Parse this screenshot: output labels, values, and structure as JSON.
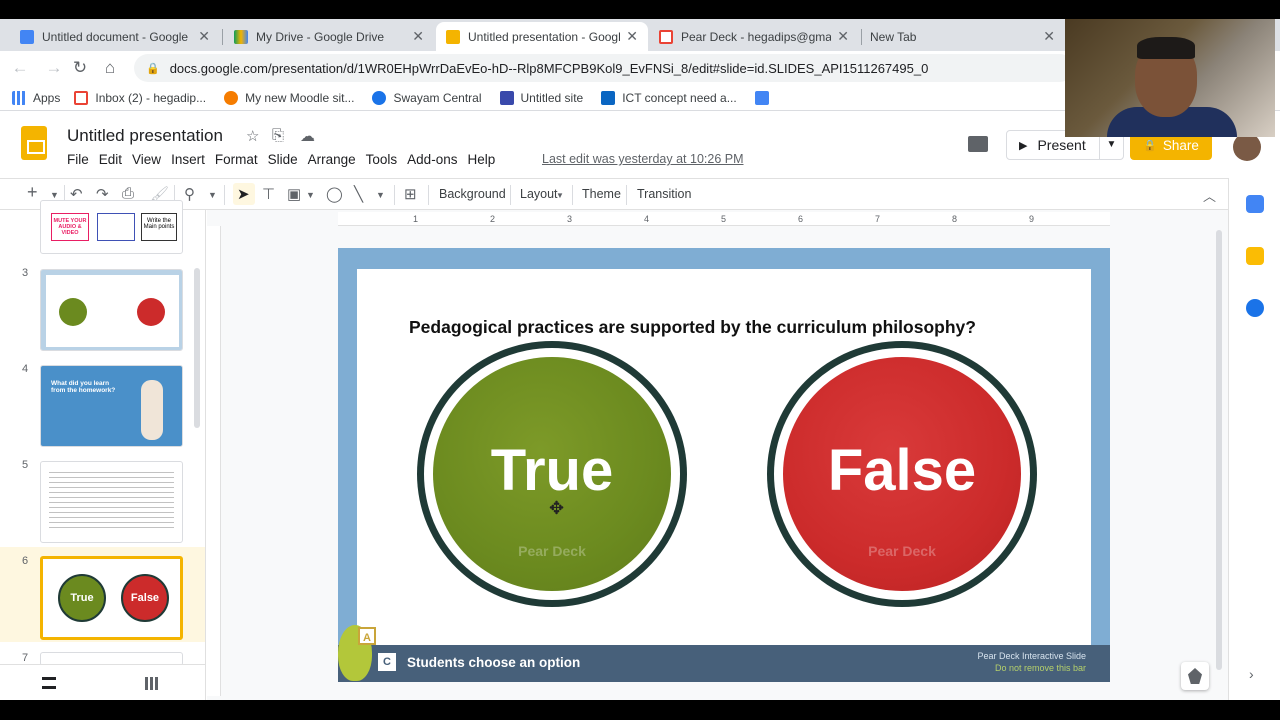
{
  "browser": {
    "tabs": [
      {
        "title": "Untitled document - Google D",
        "active": false
      },
      {
        "title": "My Drive - Google Drive",
        "active": false
      },
      {
        "title": "Untitled presentation - Google",
        "active": true
      },
      {
        "title": "Pear Deck - hegadips@gmail.c",
        "active": false
      },
      {
        "title": "New Tab",
        "active": false
      }
    ],
    "url": "docs.google.com/presentation/d/1WR0EHpWrrDaEvEo-hD--Rlp8MFCPB9Kol9_EvFNSi_8/edit#slide=id.SLIDES_API1511267495_0",
    "bookmarks": [
      {
        "label": "Apps",
        "color": "#4285f4"
      },
      {
        "label": "Inbox (2) - hegadip...",
        "color": "#ea4335"
      },
      {
        "label": "My new Moodle sit...",
        "color": "#f57c00"
      },
      {
        "label": "Swayam Central",
        "color": "#1a73e8"
      },
      {
        "label": "Untitled site",
        "color": "#3949ab"
      },
      {
        "label": "ICT concept need a...",
        "color": "#0a66c2"
      },
      {
        "label": "",
        "color": "#4285f4"
      }
    ]
  },
  "doc": {
    "title": "Untitled presentation",
    "menu": [
      "File",
      "Edit",
      "View",
      "Insert",
      "Format",
      "Slide",
      "Arrange",
      "Tools",
      "Add-ons",
      "Help"
    ],
    "last_edit": "Last edit was yesterday at 10:26 PM",
    "present_label": "Present",
    "share_label": "Share"
  },
  "toolbar": {
    "background": "Background",
    "layout": "Layout",
    "theme": "Theme",
    "transition": "Transition"
  },
  "filmstrip": {
    "numbers": [
      "3",
      "4",
      "5",
      "6",
      "7"
    ],
    "slide2_texts": [
      "MUTE YOUR AUDIO & VIDEO",
      "Write the Main points"
    ],
    "slide4_text": "What did you learn from the homework?",
    "slide6_true": "True",
    "slide6_false": "False"
  },
  "slide": {
    "question": "Pedagogical practices are supported by the curriculum philosophy?",
    "true_label": "True",
    "false_label": "False",
    "watermark": "Pear Deck",
    "bar_label": "Students choose an option",
    "bar_right_1": "Pear Deck Interactive Slide",
    "bar_right_2": "Do not remove this bar",
    "badge_a": "A",
    "badge_c": "C"
  },
  "ruler": [
    "1",
    "2",
    "3",
    "4",
    "5",
    "6",
    "7",
    "8",
    "9"
  ],
  "colors": {
    "accent": "#f4b400",
    "true_green": "#6b8a1f",
    "false_red": "#cc2b2b",
    "ring": "#1f3a36",
    "slide_border": "#7fadd3",
    "pd_bar": "#47607a"
  }
}
